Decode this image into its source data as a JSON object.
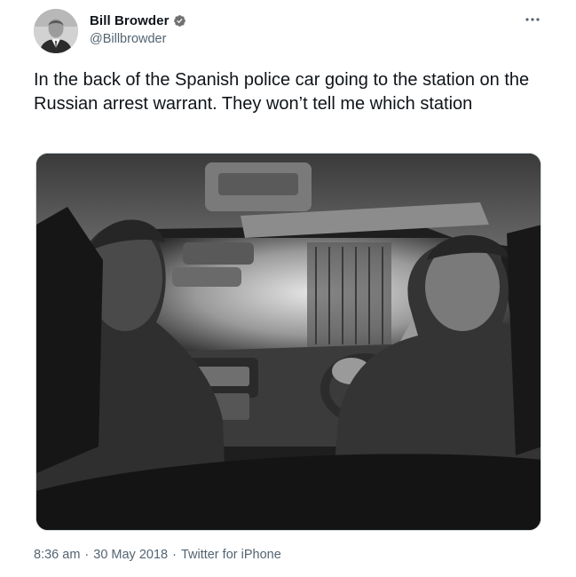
{
  "author": {
    "display_name": "Bill Browder",
    "handle": "@Billbrowder",
    "verified": true
  },
  "tweet": {
    "text": "In the back of the Spanish police car going to the station on the Russian arrest warrant. They won’t tell me which station",
    "time": "8:36 am",
    "date": "30 May 2018",
    "source": "Twitter for iPhone",
    "separator": "·"
  },
  "icons": {
    "more": "more-horizontal-icon",
    "verified": "verified-badge-icon"
  },
  "colors": {
    "text_primary": "#0f1419",
    "text_secondary": "#536471",
    "verified_badge": "#707070"
  }
}
